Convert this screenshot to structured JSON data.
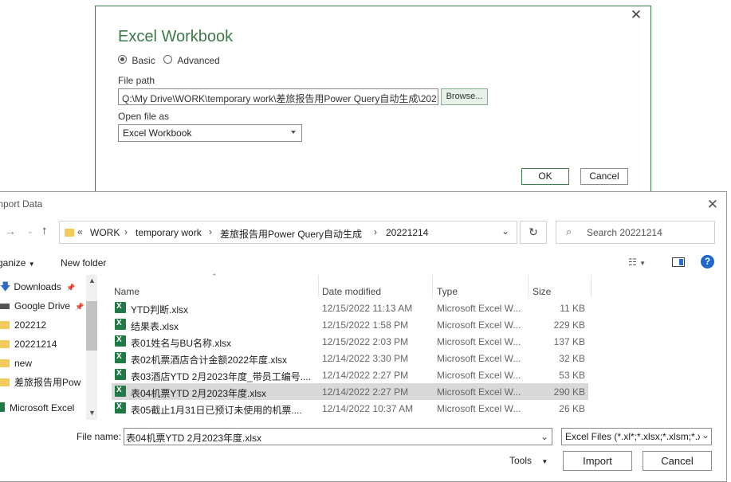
{
  "power_query_dialog": {
    "title": "Excel Workbook",
    "mode_basic": "Basic",
    "mode_advanced": "Advanced",
    "file_path_label": "File path",
    "file_path_value": "Q:\\My Drive\\WORK\\temporary work\\差旅报告用Power Query自动生成\\202",
    "browse_label": "Browse...",
    "open_as_label": "Open file as",
    "open_as_value": "Excel Workbook",
    "ok_label": "OK",
    "cancel_label": "Cancel",
    "close_glyph": "✕"
  },
  "import_dialog": {
    "title": "mport Data",
    "close_glyph": "✕",
    "breadcrumb": [
      "WORK",
      "temporary work",
      "差旅报告用Power Query自动生成",
      "20221214"
    ],
    "breadcrumb_prefix": "«",
    "search_placeholder": "Search 20221214",
    "organize_label": "ganize",
    "new_folder_label": "New folder",
    "help_glyph": "?",
    "tree_items": [
      {
        "label": "Downloads",
        "icon": "download-icon",
        "pinned": true
      },
      {
        "label": "Google Drive",
        "icon": "drive-icon",
        "pinned": true
      },
      {
        "label": "202212",
        "icon": "folder-icon"
      },
      {
        "label": "20221214",
        "icon": "folder-icon"
      },
      {
        "label": "new",
        "icon": "folder-icon"
      },
      {
        "label": "差旅报告用Pow",
        "icon": "folder-icon"
      },
      {
        "label": "Microsoft Excel",
        "icon": "excel-icon"
      }
    ],
    "columns": {
      "name": "Name",
      "date": "Date modified",
      "type": "Type",
      "size": "Size"
    },
    "files": [
      {
        "name": "YTD判断.xlsx",
        "date": "12/15/2022 11:13 AM",
        "type": "Microsoft Excel W...",
        "size": "11 KB"
      },
      {
        "name": "结果表.xlsx",
        "date": "12/15/2022 1:58 PM",
        "type": "Microsoft Excel W...",
        "size": "229 KB"
      },
      {
        "name": "表01姓名与BU名称.xlsx",
        "date": "12/15/2022 2:03 PM",
        "type": "Microsoft Excel W...",
        "size": "137 KB"
      },
      {
        "name": "表02机票酒店合计金额2022年度.xlsx",
        "date": "12/14/2022 3:30 PM",
        "type": "Microsoft Excel W...",
        "size": "32 KB"
      },
      {
        "name": "表03酒店YTD 2月2023年度_带员工编号....",
        "date": "12/14/2022 2:27 PM",
        "type": "Microsoft Excel W...",
        "size": "53 KB"
      },
      {
        "name": "表04机票YTD 2月2023年度.xlsx",
        "date": "12/14/2022 2:27 PM",
        "type": "Microsoft Excel W...",
        "size": "290 KB",
        "selected": true
      },
      {
        "name": "表05截止1月31日已预订未使用的机票....",
        "date": "12/14/2022 10:37 AM",
        "type": "Microsoft Excel W...",
        "size": "26 KB"
      }
    ],
    "file_name_label": "File name:",
    "file_name_value": "表04机票YTD 2月2023年度.xlsx",
    "filter_value": "Excel Files (*.xl*;*.xlsx;*.xlsm;*.x",
    "tools_label": "Tools",
    "import_label": "Import",
    "cancel_label": "Cancel"
  },
  "colors": {
    "accent_green": "#3b7a47",
    "selected_row": "#d9d9d9",
    "folder": "#f3cb5a",
    "excel": "#1f7a45"
  }
}
